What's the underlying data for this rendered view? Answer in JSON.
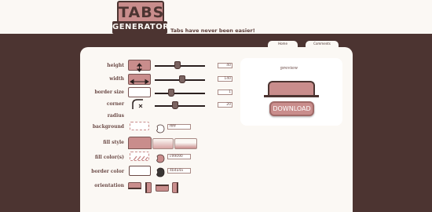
{
  "logo": {
    "top_text": "TABS",
    "bottom_text": "GENERATOR"
  },
  "tagline": "Tabs have never been easier!",
  "nav": {
    "home": "Home",
    "comments": "Comments"
  },
  "controls": {
    "height": {
      "label": "height",
      "value": "40",
      "level": 0.45
    },
    "width": {
      "label": "width",
      "value": "140",
      "level": 0.55
    },
    "border_size": {
      "label": "border size",
      "value": "1",
      "level": 0.3
    },
    "corner_radius": {
      "label_line1": "corner",
      "label_line2": "radius",
      "value": "20",
      "level": 0.4
    },
    "background": {
      "label": "background",
      "value": "fffff"
    },
    "fill_style": {
      "label": "fill style"
    },
    "fill_colors": {
      "label": "fill color(s)",
      "value": "c99090"
    },
    "border_color": {
      "label": "border color",
      "value": "4b4a4a"
    },
    "orientation": {
      "label": "orientation"
    }
  },
  "preview": {
    "label": "preview",
    "download_label": "DOWNLOAD"
  },
  "colors": {
    "brown": "#4c3431",
    "accent": "#c98d8c",
    "cream": "#fbf8f4"
  }
}
